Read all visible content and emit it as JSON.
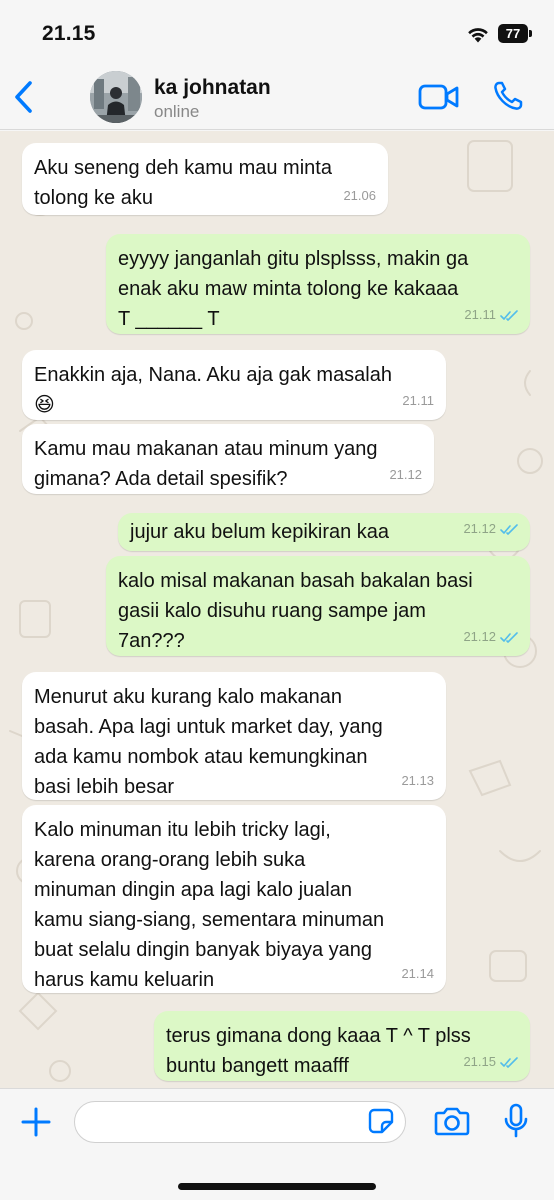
{
  "status_bar": {
    "time": "21.15",
    "battery": "77"
  },
  "header": {
    "contact_name": "ka johnatan",
    "contact_status": "online"
  },
  "messages": [
    {
      "dir": "in",
      "text": "Aku seneng deh kamu mau minta\ntolong ke aku",
      "time": "21.06"
    },
    {
      "dir": "out",
      "text": "eyyyy janganlah gitu plsplsss, makin ga\nenak aku maw minta tolong ke kakaaa\nT ______ T",
      "time": "21.11",
      "status": "read"
    },
    {
      "dir": "in",
      "text": "Enakkin aja, Nana. Aku aja gak masalah\n😆",
      "time": "21.11"
    },
    {
      "dir": "in",
      "text": "Kamu mau makanan atau minum yang\ngimana? Ada detail spesifik?",
      "time": "21.12"
    },
    {
      "dir": "out",
      "text": "jujur aku belum kepikiran kaa",
      "time": "21.12",
      "status": "read"
    },
    {
      "dir": "out",
      "text": "kalo misal makanan basah bakalan basi\ngasii kalo disuhu ruang sampe jam\n7an???",
      "time": "21.12",
      "status": "read"
    },
    {
      "dir": "in",
      "text": "Menurut aku kurang kalo makanan\nbasah. Apa lagi untuk market day, yang\nada kamu nombok atau kemungkinan\nbasi lebih besar",
      "time": "21.13"
    },
    {
      "dir": "in",
      "text": "Kalo minuman itu lebih tricky lagi,\nkarena orang-orang lebih suka\nminuman dingin apa lagi kalo jualan\nkamu siang-siang, sementara minuman\nbuat selalu dingin banyak biyaya yang\nharus kamu keluarin",
      "time": "21.14"
    },
    {
      "dir": "out",
      "text": "terus gimana dong kaaa T ^ T plss\nbuntu bangett maafff",
      "time": "21.15",
      "status": "read"
    }
  ],
  "input": {
    "placeholder": ""
  },
  "colors": {
    "accent": "#007aff",
    "outgoing_bubble": "#dcf8c6",
    "incoming_bubble": "#ffffff",
    "read_tick": "#53bdeb",
    "chat_background": "#efeae2"
  },
  "icons": [
    "back-icon",
    "video-call-icon",
    "phone-icon",
    "plus-icon",
    "sticker-icon",
    "camera-icon",
    "microphone-icon",
    "wifi-icon",
    "double-tick-icon"
  ]
}
